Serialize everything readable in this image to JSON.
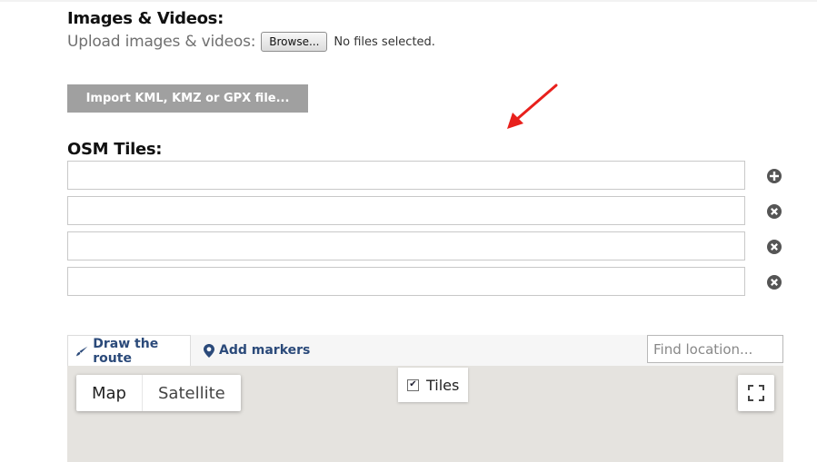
{
  "images": {
    "title": "Images & Videos:",
    "upload_label": "Upload images & videos:",
    "browse_label": "Browse...",
    "no_files": "No files selected."
  },
  "import": {
    "label": "Import KML, KMZ or GPX file..."
  },
  "osm": {
    "title": "OSM Tiles:",
    "inputs": [
      {
        "value": "",
        "action_icon": "plus-circle-icon"
      },
      {
        "value": "",
        "action_icon": "x-circle-icon"
      },
      {
        "value": "",
        "action_icon": "x-circle-icon"
      },
      {
        "value": "",
        "action_icon": "x-circle-icon"
      }
    ]
  },
  "annotation": {
    "icon": "red-arrow-icon",
    "color": "#e8201c"
  },
  "editor": {
    "tabs": [
      {
        "label": "Draw the route",
        "icon": "brush-icon",
        "active": true
      },
      {
        "label": "Add markers",
        "icon": "map-pin-icon",
        "active": false
      }
    ],
    "find_placeholder": "Find location..."
  },
  "map": {
    "map_types": [
      "Map",
      "Satellite"
    ],
    "selected_type": "Map",
    "tiles_label": "Tiles",
    "tiles_checked": true
  },
  "colors": {
    "tab_text": "#2b4a7a",
    "import_button": "#a0a0a0",
    "map_background": "#e5e3df"
  }
}
